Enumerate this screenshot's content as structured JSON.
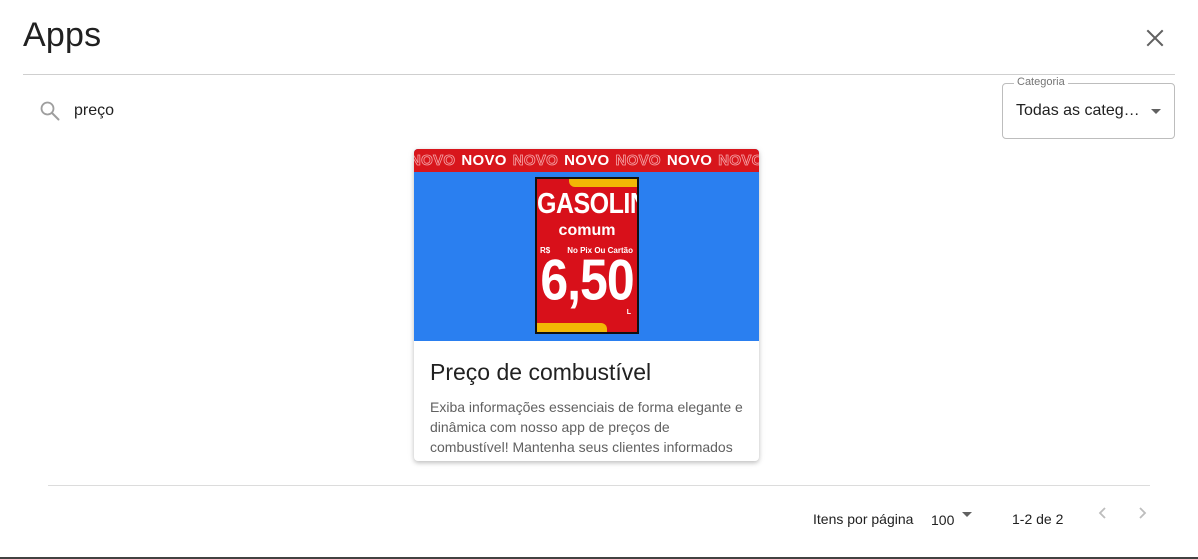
{
  "dialog": {
    "title": "Apps",
    "close_icon": "close-icon"
  },
  "search": {
    "icon": "search-icon",
    "value": "preço",
    "placeholder": ""
  },
  "category": {
    "label": "Categoria",
    "value": "Todas as categ…",
    "icon": "chevron-down-icon"
  },
  "apps": [
    {
      "title": "Preço de combustível",
      "description": "Exiba informações essenciais de forma elegante e dinâmica com nosso app de preços de combustível! Mantenha seus clientes informados",
      "thumbnail": {
        "ribbon_word": "NOVO",
        "sign_title": "GASOLINA",
        "sign_subtitle": "comum",
        "sign_currency": "R$",
        "sign_payment": "No Pix Ou Cartão",
        "sign_price": "6,50",
        "sign_unit": "L",
        "colors": {
          "background": "#2a7ff0",
          "red": "#d8101a",
          "yellow": "#f2b705"
        }
      }
    }
  ],
  "pagination": {
    "items_per_page_label": "Itens por página",
    "items_per_page_value": "100",
    "range_label": "1-2 de 2",
    "prev_icon": "chevron-left-icon",
    "next_icon": "chevron-right-icon"
  }
}
